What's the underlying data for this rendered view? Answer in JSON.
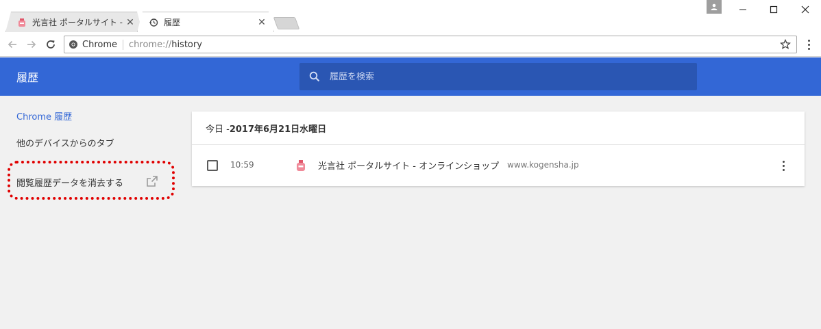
{
  "tabs": [
    {
      "title": "光言社 ポータルサイト - オンラインショップ",
      "close": "✕"
    },
    {
      "title": "履歴",
      "close": "✕"
    }
  ],
  "window": {
    "minimize": "—",
    "maximize": "☐",
    "close": "✕"
  },
  "omnibox": {
    "chip": "Chrome",
    "url_scheme": "chrome://",
    "url_path": "history"
  },
  "header": {
    "title": "履歴",
    "search_placeholder": "履歴を検索"
  },
  "sidebar": {
    "items": [
      {
        "label": "Chrome 履歴",
        "active": true
      },
      {
        "label": "他のデバイスからのタブ",
        "active": false
      },
      {
        "label": "閲覧履歴データを消去する",
        "active": false
      }
    ]
  },
  "history": {
    "date_prefix": "今日 - ",
    "date": "2017年6月21日水曜日",
    "entries": [
      {
        "time": "10:59",
        "title": "光言社 ポータルサイト - オンラインショップ",
        "domain": "www.kogensha.jp"
      }
    ]
  },
  "colors": {
    "accent": "#3367d6",
    "search_bg": "#2a56b3",
    "highlight": "#e00000",
    "favicon": "#e0566a"
  }
}
